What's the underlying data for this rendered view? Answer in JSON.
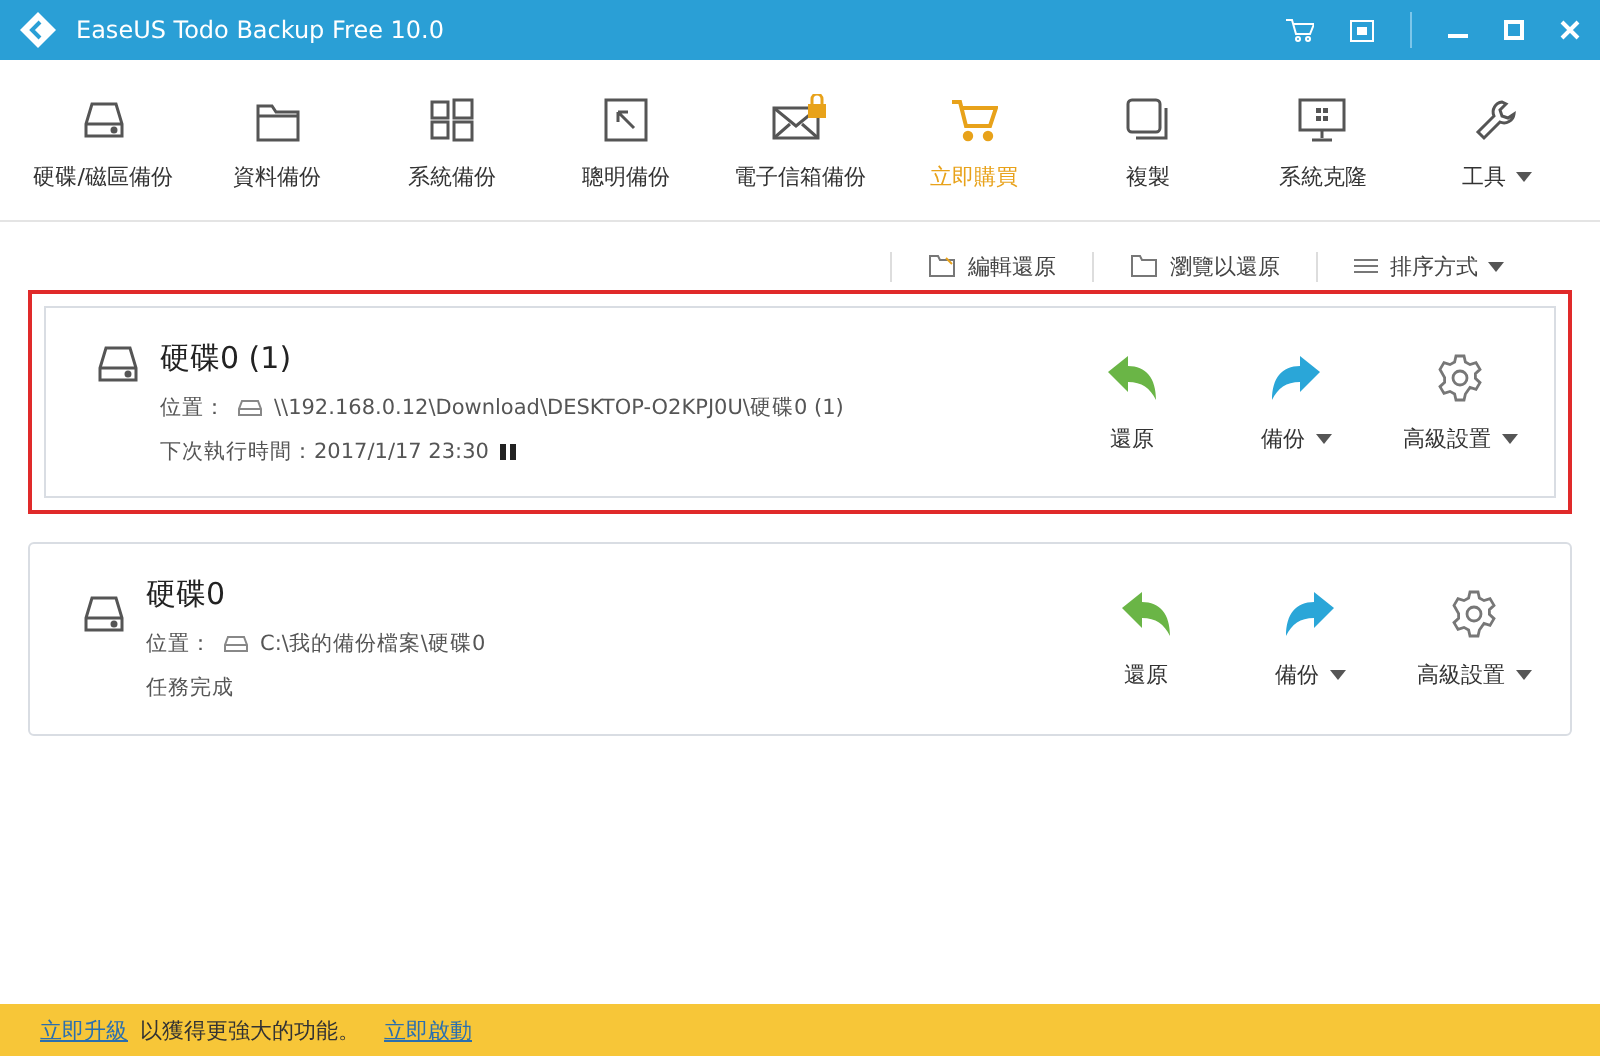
{
  "window": {
    "title": "EaseUS Todo Backup Free 10.0"
  },
  "toolbar": [
    {
      "kind": "disk",
      "label": "硬碟/磁區備份",
      "highlight": false,
      "dropdown": false
    },
    {
      "kind": "folder",
      "label": "資料備份",
      "highlight": false,
      "dropdown": false
    },
    {
      "kind": "windows",
      "label": "系統備份",
      "highlight": false,
      "dropdown": false
    },
    {
      "kind": "smart",
      "label": "聰明備份",
      "highlight": false,
      "dropdown": false
    },
    {
      "kind": "mail",
      "label": "電子信箱備份",
      "highlight": false,
      "dropdown": false
    },
    {
      "kind": "cart",
      "label": "立即購買",
      "highlight": true,
      "dropdown": false
    },
    {
      "kind": "clone",
      "label": "複製",
      "highlight": false,
      "dropdown": false
    },
    {
      "kind": "monitor",
      "label": "系統克隆",
      "highlight": false,
      "dropdown": false
    },
    {
      "kind": "wrench",
      "label": "工具",
      "highlight": false,
      "dropdown": true
    }
  ],
  "subtoolbar": [
    {
      "kind": "edit",
      "label": "編輯還原",
      "dropdown": false
    },
    {
      "kind": "browse",
      "label": "瀏覽以還原",
      "dropdown": false
    },
    {
      "kind": "sort",
      "label": "排序方式",
      "dropdown": true
    }
  ],
  "tasks": [
    {
      "name": "硬碟0 (1)",
      "location_label": "位置：",
      "location": "\\\\192.168.0.12\\Download\\DESKTOP-O2KPJ0U\\硬碟0 (1)",
      "status": "下次執行時間：2017/1/17 23:30",
      "paused": true,
      "selected": true,
      "actions": [
        {
          "kind": "restore",
          "label": "還原",
          "dropdown": false
        },
        {
          "kind": "backup",
          "label": "備份",
          "dropdown": true
        },
        {
          "kind": "settings",
          "label": "高級設置",
          "dropdown": true
        }
      ]
    },
    {
      "name": "硬碟0",
      "location_label": "位置：",
      "location": "C:\\我的備份檔案\\硬碟0",
      "status": "任務完成",
      "paused": false,
      "selected": false,
      "actions": [
        {
          "kind": "restore",
          "label": "還原",
          "dropdown": false
        },
        {
          "kind": "backup",
          "label": "備份",
          "dropdown": true
        },
        {
          "kind": "settings",
          "label": "高級設置",
          "dropdown": true
        }
      ]
    }
  ],
  "footer": {
    "upgrade_link": "立即升級",
    "text": "以獲得更強大的功能。",
    "activate_link": "立即啟動"
  }
}
